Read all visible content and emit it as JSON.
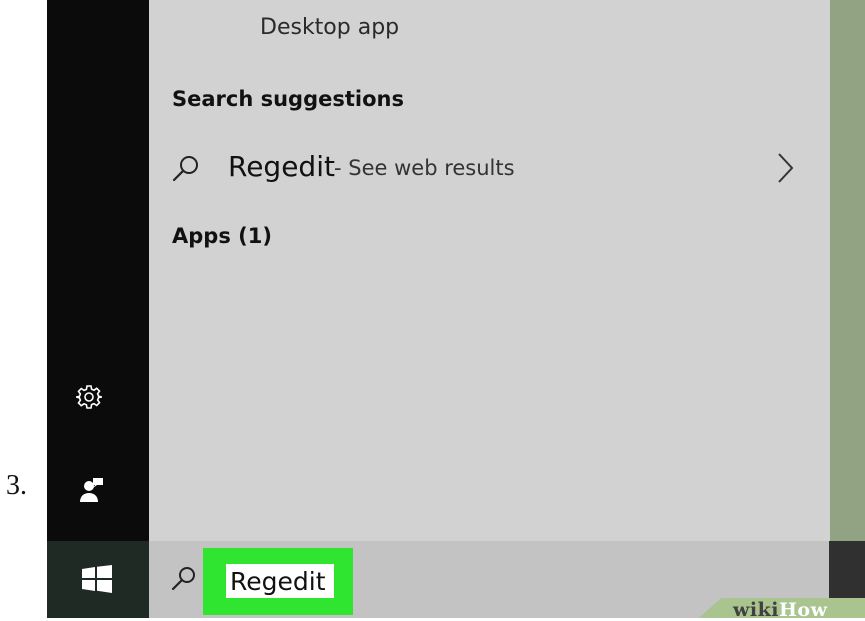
{
  "step_number": "3.",
  "start_menu": {
    "top_result_type": "Desktop app",
    "search_suggestions_heading": "Search suggestions",
    "suggestion": {
      "term": "Regedit",
      "tail": " - See web results",
      "icon": "search-icon",
      "chevron": "chevron-right-icon"
    },
    "apps_heading": "Apps (1)",
    "rail_icons": [
      "settings-icon",
      "user-feedback-icon"
    ]
  },
  "taskbar": {
    "start_icon": "windows-logo-icon",
    "search_icon": "search-icon",
    "search_value": "Regedit",
    "highlight_color": "#2fe52f"
  },
  "watermark": {
    "wiki": "wiki",
    "how": "How"
  },
  "colors": {
    "rail": "#0b0b0b",
    "panel": "#d2d2d2",
    "taskbar": "#c3c3c3",
    "accent_green": "#2fe52f"
  }
}
